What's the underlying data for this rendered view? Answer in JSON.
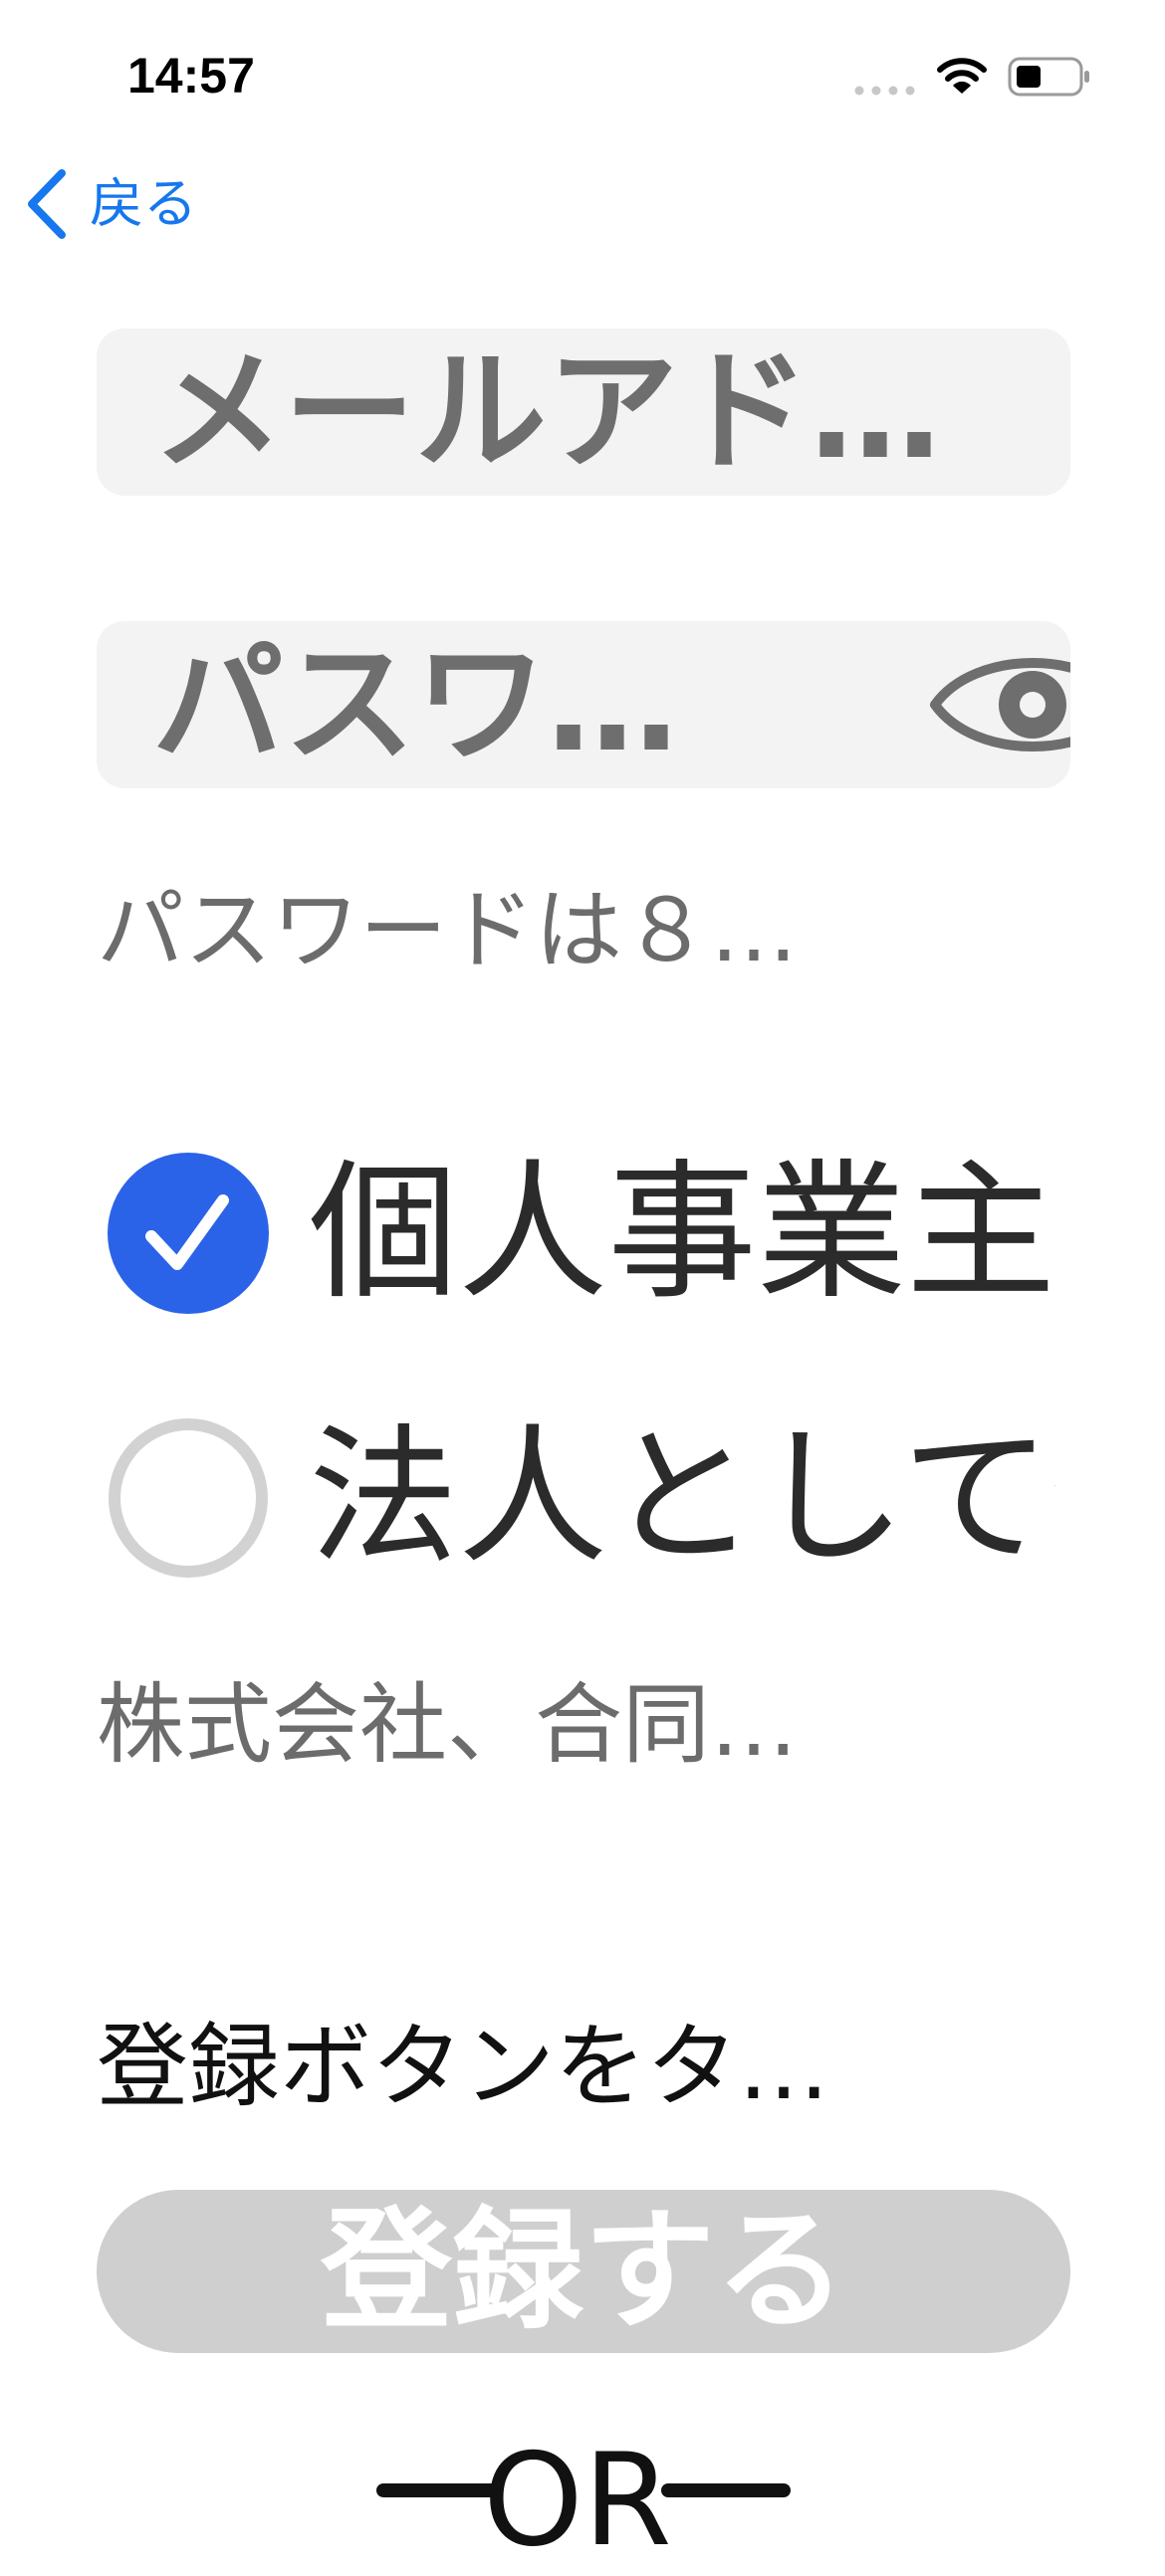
{
  "status_bar": {
    "time": "14:57",
    "icons": [
      "signal-dots-icon",
      "wifi-icon",
      "battery-icon"
    ]
  },
  "nav": {
    "back_label": "戻る",
    "back_icon": "chevron-left-icon"
  },
  "form": {
    "email_placeholder": "メールアドレス",
    "password_placeholder": "パスワード",
    "password_hint": "パスワードは８…",
    "business_options": [
      {
        "label": "個人事業主として登録",
        "selected": true
      },
      {
        "label": "法人として登録",
        "selected": false
      }
    ],
    "corporate_note": "株式会社、合同…",
    "instruction": "登録ボタンをタ…",
    "submit_label": "登録する",
    "divider_label": "OR"
  },
  "colors": {
    "accent_blue": "#1677ee",
    "radio_selected": "#2b63e8",
    "radio_unselected": "#d2d2d2",
    "field_bg": "#f4f3f4",
    "button_disabled": "#cfcfcf",
    "placeholder_text": "#6e6e6e"
  }
}
